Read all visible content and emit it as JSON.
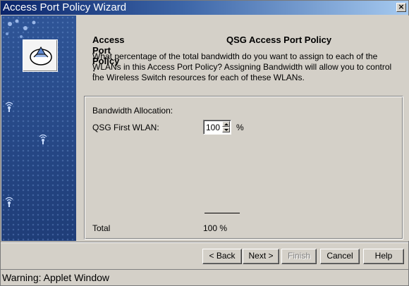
{
  "window": {
    "title": "Access Port Policy Wizard",
    "close_glyph": "×"
  },
  "header": {
    "label": "Access Port Policy :",
    "value": "QSG Access Port Policy"
  },
  "description": "What percentage of the total bandwidth do you want to assign to each of the WLANs in this Access Port Policy? Assigning Bandwidth will allow you to control the Wireless Switch resources for each of these WLANs.",
  "allocation": {
    "title": "Bandwidth Allocation:",
    "wlans": [
      {
        "label": "QSG First WLAN:",
        "value": "100",
        "unit": "%"
      }
    ],
    "total_label": "Total",
    "total_value": "100 %"
  },
  "buttons": {
    "back": "< Back",
    "next": "Next >",
    "finish": "Finish",
    "cancel": "Cancel",
    "help": "Help"
  },
  "status_bar": "Warning: Applet Window",
  "icons": {
    "logo": "wizard-logo-icon",
    "wifi": "wireless-signal-icon"
  },
  "colors": {
    "title_bar_start": "#0a246a",
    "title_bar_end": "#a6caf0",
    "side_panel": "#2c4d8a",
    "face": "#d4d0c8"
  }
}
